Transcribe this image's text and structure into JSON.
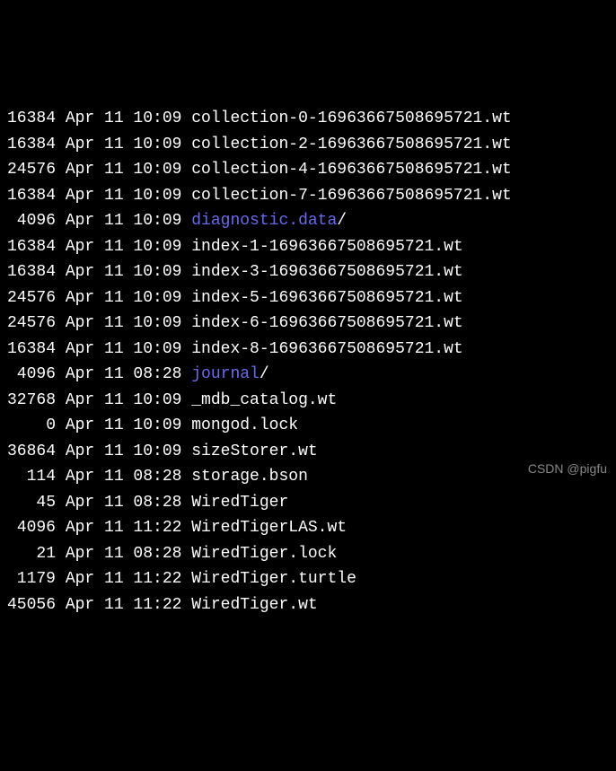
{
  "entries": [
    {
      "size": "16384",
      "date": "Apr 11 10:09",
      "name": "collection-0-16963667508695721.wt",
      "dir": false
    },
    {
      "size": "16384",
      "date": "Apr 11 10:09",
      "name": "collection-2-16963667508695721.wt",
      "dir": false
    },
    {
      "size": "24576",
      "date": "Apr 11 10:09",
      "name": "collection-4-16963667508695721.wt",
      "dir": false
    },
    {
      "size": "16384",
      "date": "Apr 11 10:09",
      "name": "collection-7-16963667508695721.wt",
      "dir": false
    },
    {
      "size": "4096",
      "date": "Apr 11 10:09",
      "name": "diagnostic.data",
      "suffix": "/",
      "dir": true
    },
    {
      "size": "16384",
      "date": "Apr 11 10:09",
      "name": "index-1-16963667508695721.wt",
      "dir": false
    },
    {
      "size": "16384",
      "date": "Apr 11 10:09",
      "name": "index-3-16963667508695721.wt",
      "dir": false
    },
    {
      "size": "24576",
      "date": "Apr 11 10:09",
      "name": "index-5-16963667508695721.wt",
      "dir": false
    },
    {
      "size": "24576",
      "date": "Apr 11 10:09",
      "name": "index-6-16963667508695721.wt",
      "dir": false
    },
    {
      "size": "16384",
      "date": "Apr 11 10:09",
      "name": "index-8-16963667508695721.wt",
      "dir": false
    },
    {
      "size": "4096",
      "date": "Apr 11 08:28",
      "name": "journal",
      "suffix": "/",
      "dir": true
    },
    {
      "size": "32768",
      "date": "Apr 11 10:09",
      "name": "_mdb_catalog.wt",
      "dir": false
    },
    {
      "size": "0",
      "date": "Apr 11 10:09",
      "name": "mongod.lock",
      "dir": false
    },
    {
      "size": "36864",
      "date": "Apr 11 10:09",
      "name": "sizeStorer.wt",
      "dir": false
    },
    {
      "size": "114",
      "date": "Apr 11 08:28",
      "name": "storage.bson",
      "dir": false
    },
    {
      "size": "45",
      "date": "Apr 11 08:28",
      "name": "WiredTiger",
      "dir": false
    },
    {
      "size": "4096",
      "date": "Apr 11 11:22",
      "name": "WiredTigerLAS.wt",
      "dir": false
    },
    {
      "size": "21",
      "date": "Apr 11 08:28",
      "name": "WiredTiger.lock",
      "dir": false
    },
    {
      "size": "1179",
      "date": "Apr 11 11:22",
      "name": "WiredTiger.turtle",
      "dir": false
    },
    {
      "size": "45056",
      "date": "Apr 11 11:22",
      "name": "WiredTiger.wt",
      "dir": false
    }
  ],
  "watermark": "CSDN @pigfu"
}
